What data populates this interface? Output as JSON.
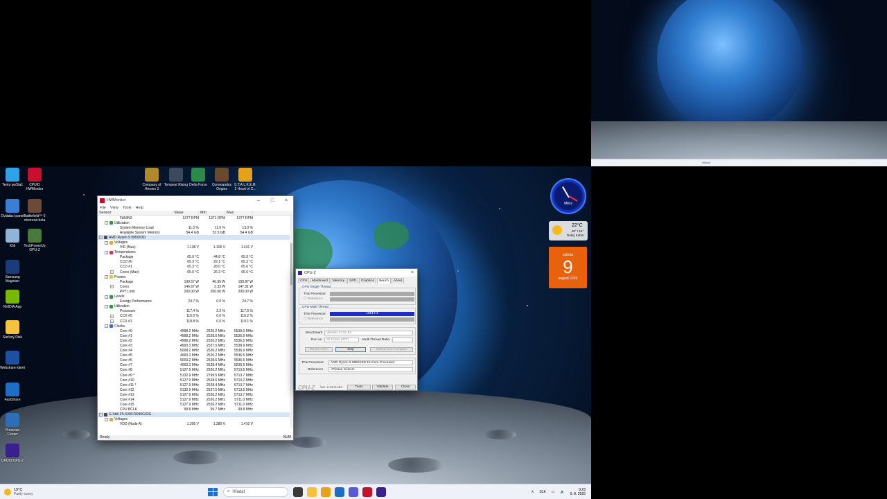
{
  "preview": {
    "search_text": "Hľadať"
  },
  "desktop_icons": [
    {
      "label": "Tento počítač",
      "color": "#2fa3e8"
    },
    {
      "label": "CPUID HWMonitor",
      "color": "#c8102e"
    },
    {
      "label": "Ovládací panel",
      "color": "#3a7fd5"
    },
    {
      "label": "Battlefield™ 6 otvorená beta",
      "color": "#6b4a3a"
    },
    {
      "label": "Kôš",
      "color": "#8fb4d8"
    },
    {
      "label": "TechPowerUp GPU-Z",
      "color": "#4a7a3a"
    },
    {
      "label": "Samsung Magician",
      "color": "#1b3b7a"
    },
    {
      "label": "NVIDIA App",
      "color": "#76b900"
    },
    {
      "label": "Sieťový Disk",
      "color": "#f5c33b"
    },
    {
      "label": "Webshare klient",
      "color": "#1e4fa0"
    },
    {
      "label": "FastShare",
      "color": "#1e6ec8"
    },
    {
      "label": "Precision Center",
      "color": "#2a6fb8"
    },
    {
      "label": "CPUID CPU-Z",
      "color": "#3a1f8f"
    }
  ],
  "top_icons": [
    {
      "label": "Company of Heroes 3",
      "color": "#b08a2a"
    },
    {
      "label": "Tempest Rising",
      "color": "#3a4a5a"
    },
    {
      "label": "Delta Force",
      "color": "#2a8a4a"
    },
    {
      "label": "Commandos Origins",
      "color": "#6a4a2a"
    },
    {
      "label": "S.T.A.L.K.E.R. 2 Heart of C...",
      "color": "#e3a21a"
    }
  ],
  "widgets": {
    "clock_label": "Milos",
    "weather": {
      "temp": "22°C",
      "range": "20° / 15°",
      "city": "Dolný Kubín"
    },
    "calendar": {
      "day_name": "sobota",
      "day": "9",
      "month_year": "august 2025"
    }
  },
  "hwmonitor": {
    "title": "HWMonitor",
    "menu": [
      "File",
      "View",
      "Tools",
      "Help"
    ],
    "columns": [
      "Sensor",
      "Value",
      "Min",
      "Max"
    ],
    "rows": [
      {
        "indent": 3,
        "name": "FANIN3",
        "v": "1377 RPM",
        "min": "1371 RPM",
        "max": "1377 RPM"
      },
      {
        "indent": 2,
        "tog": "-",
        "icon": "#2a9a3a",
        "name": "Utilization"
      },
      {
        "indent": 3,
        "name": "System Memory Load",
        "v": "11.0 %",
        "min": "11.0 %",
        "max": "13.0 %"
      },
      {
        "indent": 3,
        "name": "Available System Memory",
        "v": "54.4 GB",
        "min": "53.5 GB",
        "max": "54.4 GB"
      },
      {
        "indent": 1,
        "tog": "-",
        "icon": "#4a4a4a",
        "name": "AMD Ryzen 9 9950X3D",
        "sel": true
      },
      {
        "indent": 2,
        "tog": "-",
        "icon": "#e8a23a",
        "name": "Voltages"
      },
      {
        "indent": 3,
        "name": "VID (Max)",
        "v": "1.138 V",
        "min": "1.106 V",
        "max": "1.431 V"
      },
      {
        "indent": 2,
        "tog": "-",
        "icon": "#d83a3a",
        "name": "Temperatures"
      },
      {
        "indent": 3,
        "name": "Package",
        "v": "65.9 °C",
        "min": "44.8 °C",
        "max": "65.9 °C"
      },
      {
        "indent": 3,
        "name": "CCD #0",
        "v": "65.3 °C",
        "min": "29.1 °C",
        "max": "65.3 °C"
      },
      {
        "indent": 3,
        "name": "CCD #1",
        "v": "65.3 °C",
        "min": "28.0 °C",
        "max": "65.6 °C"
      },
      {
        "indent": 3,
        "tog": "+",
        "name": "Cores (Max)",
        "v": "65.6 °C",
        "min": "26.3 °C",
        "max": "65.6 °C"
      },
      {
        "indent": 2,
        "tog": "-",
        "icon": "#e8c33a",
        "name": "Powers"
      },
      {
        "indent": 3,
        "name": "Package",
        "v": "199.57 W",
        "min": "46.99 W",
        "max": "199.87 W"
      },
      {
        "indent": 3,
        "tog": "+",
        "name": "Cores",
        "v": "146.67 W",
        "min": "2.33 W",
        "max": "147.31 W"
      },
      {
        "indent": 3,
        "name": "PPT Limit",
        "v": "200.00 W",
        "min": "200.00 W",
        "max": "200.00 W"
      },
      {
        "indent": 2,
        "tog": "-",
        "icon": "#2a9a3a",
        "name": "Levels"
      },
      {
        "indent": 3,
        "name": "Energy Performance",
        "v": "24.7 %",
        "min": "0.0 %",
        "max": "24.7 %"
      },
      {
        "indent": 2,
        "tog": "-",
        "icon": "#2a9a3a",
        "name": "Utilization"
      },
      {
        "indent": 3,
        "name": "Processor",
        "v": "117.4 %",
        "min": "2.2 %",
        "max": "117.6 %"
      },
      {
        "indent": 3,
        "tog": "+",
        "name": "CCX #0",
        "v": "116.0 %",
        "min": "0.0 %",
        "max": "116.2 %"
      },
      {
        "indent": 3,
        "tog": "+",
        "name": "CCX #1",
        "v": "118.8 %",
        "min": "0.0 %",
        "max": "119.1 %"
      },
      {
        "indent": 2,
        "tog": "-",
        "icon": "#3a6ad8",
        "name": "Clocks"
      },
      {
        "indent": 3,
        "name": "Core #0",
        "v": "4998.2 MHz",
        "min": "2526.2 MHz",
        "max": "5539.0 MHz"
      },
      {
        "indent": 3,
        "name": "Core #1",
        "v": "4998.2 MHz",
        "min": "2528.6 MHz",
        "max": "5536.9 MHz"
      },
      {
        "indent": 3,
        "name": "Core #2",
        "v": "4998.2 MHz",
        "min": "2526.2 MHz",
        "max": "5536.5 MHz"
      },
      {
        "indent": 3,
        "name": "Core #3",
        "v": "4993.3 MHz",
        "min": "2527.5 MHz",
        "max": "5538.9 MHz"
      },
      {
        "indent": 3,
        "name": "Core #4",
        "v": "5008.2 MHz",
        "min": "2526.2 MHz",
        "max": "5536.9 MHz"
      },
      {
        "indent": 3,
        "name": "Core #5",
        "v": "4993.3 MHz",
        "min": "2526.2 MHz",
        "max": "5536.5 MHz"
      },
      {
        "indent": 3,
        "name": "Core #6",
        "v": "5003.2 MHz",
        "min": "2528.6 MHz",
        "max": "5536.5 MHz"
      },
      {
        "indent": 3,
        "name": "Core #7",
        "v": "4993.3 MHz",
        "min": "2528.4 MHz",
        "max": "5536.5 MHz"
      },
      {
        "indent": 3,
        "name": "Core #8",
        "v": "5127.9 MHz",
        "min": "2526.2 MHz",
        "max": "5713.5 MHz"
      },
      {
        "indent": 3,
        "name": "Core #9 *",
        "v": "5132.9 MHz",
        "min": "2799.5 MHz",
        "max": "5713.7 MHz"
      },
      {
        "indent": 3,
        "name": "Core #10",
        "v": "5127.9 MHz",
        "min": "2528.6 MHz",
        "max": "5713.2 MHz"
      },
      {
        "indent": 3,
        "name": "Core #11 *",
        "v": "5127.9 MHz",
        "min": "2528.4 MHz",
        "max": "5713.7 MHz"
      },
      {
        "indent": 3,
        "name": "Core #12",
        "v": "5132.9 MHz",
        "min": "2527.5 MHz",
        "max": "5713.5 MHz"
      },
      {
        "indent": 3,
        "name": "Core #13",
        "v": "5127.9 MHz",
        "min": "2526.2 MHz",
        "max": "5713.7 MHz"
      },
      {
        "indent": 3,
        "name": "Core #14",
        "v": "5127.9 MHz",
        "min": "2526.2 MHz",
        "max": "5711.0 MHz"
      },
      {
        "indent": 3,
        "name": "Core #15",
        "v": "5127.9 MHz",
        "min": "2526.2 MHz",
        "max": "5711.0 MHz"
      },
      {
        "indent": 3,
        "name": "CPU BCLK",
        "v": "99.8 MHz",
        "min": "99.7 MHz",
        "max": "99.8 MHz"
      },
      {
        "indent": 1,
        "tog": "-",
        "icon": "#4a4a4a",
        "name": "G.Skill F5-6000J3040G32G",
        "sel": true
      },
      {
        "indent": 2,
        "tog": "-",
        "icon": "#e8a23a",
        "name": "Voltages"
      },
      {
        "indent": 3,
        "name": "VDD (Node A)",
        "v": "1.395 V",
        "min": "1.380 V",
        "max": "1.410 V"
      },
      {
        "indent": 3,
        "name": "VDDQ",
        "v": "1.410 V",
        "min": "1.395 V",
        "max": "1.410 V"
      }
    ],
    "status_left": "Ready",
    "status_right": "NUM"
  },
  "cpuz": {
    "title": "CPU-Z",
    "tabs": [
      "CPU",
      "Mainboard",
      "Memory",
      "SPD",
      "Graphics",
      "Bench",
      "About"
    ],
    "active_tab": "Bench",
    "single_group": "CPU Single Thread",
    "multi_group": "CPU Multi Thread",
    "this_processor": "This Processor",
    "reference": "Reference",
    "multi_score": "16617.4",
    "multi_fill": 1.0,
    "benchmark_label": "Benchmark",
    "benchmark_value": "Version 17.01.64",
    "runon_label": "Run on",
    "runon_value": "All Cores (32T)",
    "ratio_label": "Multi Thread Ratio",
    "bench_cpu": "Bench CPU",
    "stop": "Stop",
    "submit": "Submit and Compare",
    "proc_label": "This Processor",
    "proc_value": "AMD Ryzen 9 9950X3D 16-Core Processor",
    "ref_label": "Reference",
    "ref_value": "<Please Select>",
    "brand": "CPU-Z",
    "version": "Ver. 2.16.0.x64",
    "tools": "Tools",
    "validate": "Validate",
    "close": "Close"
  },
  "taskbar": {
    "weather_temp": "19°C",
    "weather_desc": "Partly sunny",
    "search": "Hľadať",
    "lang": "SLK",
    "time": "9:23",
    "date": "9. 8. 2025",
    "apps": [
      "#3a3a3a",
      "#f5c33b",
      "#e8a21a",
      "#1e6ec8",
      "#5a5ad8",
      "#c8102e",
      "#3a1f8f"
    ]
  }
}
